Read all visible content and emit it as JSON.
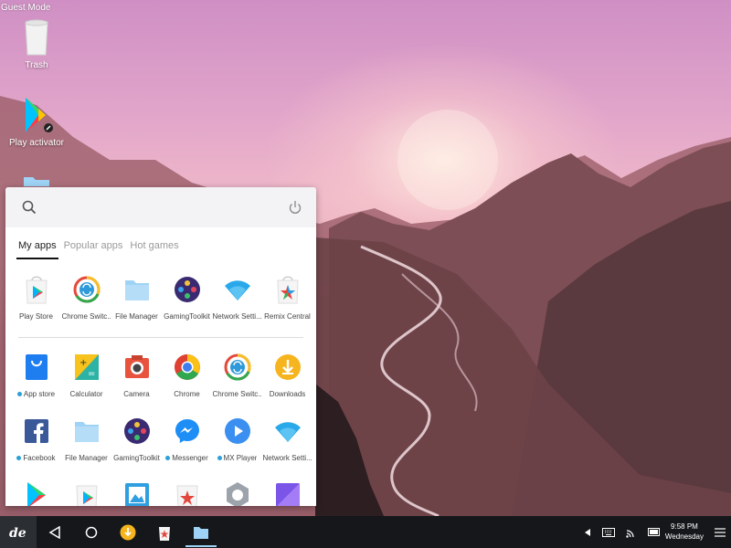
{
  "desktop": {
    "mode_label": "Guest Mode",
    "icons": [
      {
        "label": "Trash",
        "icon": "trash-icon"
      },
      {
        "label": "Play activator",
        "icon": "play-activator-icon"
      },
      {
        "label": "",
        "icon": "folder-icon"
      }
    ]
  },
  "start_menu": {
    "search": {
      "icon": "search-icon",
      "power_icon": "power-icon"
    },
    "tabs": [
      {
        "label": "My apps",
        "active": true
      },
      {
        "label": "Popular apps",
        "active": false
      },
      {
        "label": "Hot games",
        "active": false
      }
    ],
    "pinned_apps": [
      {
        "label": "Play Store",
        "icon": "play-store-icon",
        "dot": false
      },
      {
        "label": "Chrome Switc...",
        "icon": "chrome-switcher-icon",
        "dot": false
      },
      {
        "label": "File Manager",
        "icon": "folder-icon",
        "dot": false
      },
      {
        "label": "GamingToolkit",
        "icon": "gaming-toolkit-icon",
        "dot": false
      },
      {
        "label": "Network Setti...",
        "icon": "wifi-icon",
        "dot": false
      },
      {
        "label": "Remix Central",
        "icon": "remix-central-icon",
        "dot": false
      }
    ],
    "all_apps": [
      {
        "label": "App store",
        "icon": "app-store-icon",
        "dot": true
      },
      {
        "label": "Calculator",
        "icon": "calculator-icon",
        "dot": false
      },
      {
        "label": "Camera",
        "icon": "camera-icon",
        "dot": false
      },
      {
        "label": "Chrome",
        "icon": "chrome-icon",
        "dot": false
      },
      {
        "label": "Chrome Switc...",
        "icon": "chrome-switcher-icon",
        "dot": false
      },
      {
        "label": "Downloads",
        "icon": "downloads-icon",
        "dot": false
      },
      {
        "label": "Facebook",
        "icon": "facebook-icon",
        "dot": true
      },
      {
        "label": "File Manager",
        "icon": "folder-icon",
        "dot": false
      },
      {
        "label": "GamingToolkit",
        "icon": "gaming-toolkit-icon",
        "dot": false
      },
      {
        "label": "Messenger",
        "icon": "messenger-icon",
        "dot": true
      },
      {
        "label": "MX Player",
        "icon": "mx-player-icon",
        "dot": true
      },
      {
        "label": "Network Setti...",
        "icon": "wifi-icon",
        "dot": false
      }
    ]
  },
  "taskbar": {
    "start_icon": "jide-logo-icon",
    "nav": [
      "back-icon",
      "home-icon"
    ],
    "pinned": [
      "downloads-icon",
      "remix-central-icon",
      "folder-icon"
    ],
    "tray": [
      "expand-icon",
      "keyboard-icon",
      "cast-icon",
      "battery-icon",
      "notifications-icon"
    ],
    "clock": {
      "time": "9:58 PM",
      "day": "Wednesday"
    }
  },
  "colors": {
    "taskbar_bg": "#15171a",
    "accent": "#2aa0d8",
    "menu_bg": "#ffffff"
  }
}
